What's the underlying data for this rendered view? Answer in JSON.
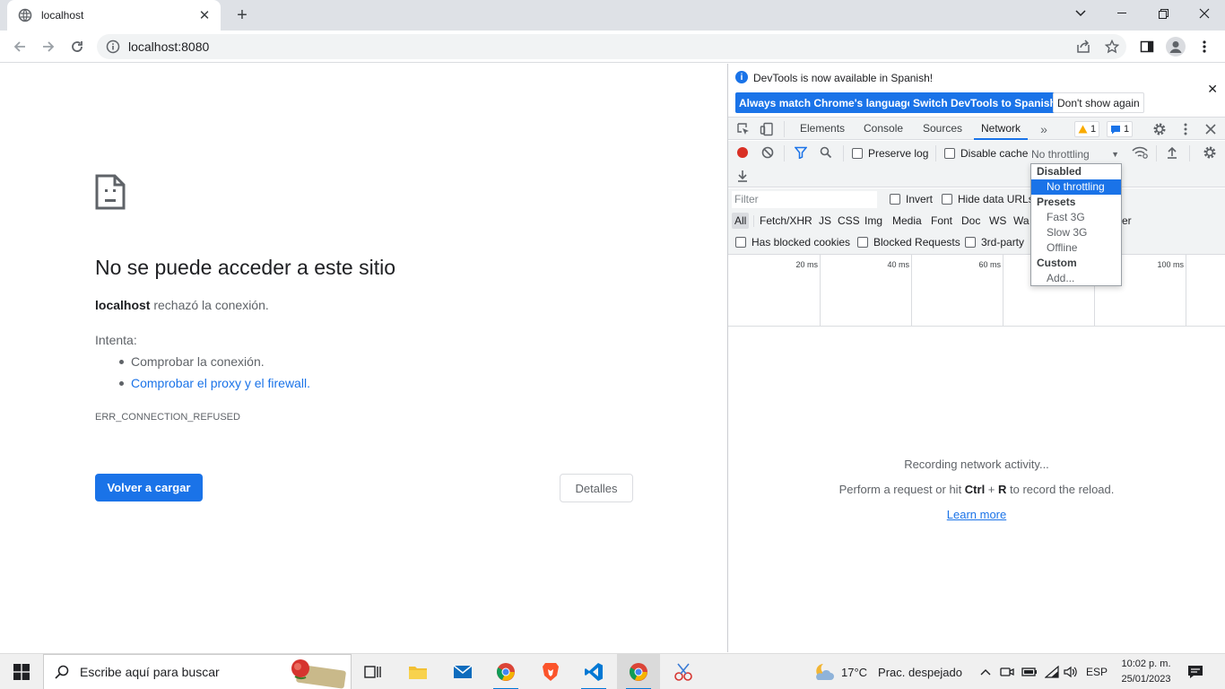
{
  "browser": {
    "tab_title": "localhost",
    "url": "localhost:8080"
  },
  "page": {
    "title": "No se puede acceder a este sitio",
    "host": "localhost",
    "desc_rest": " rechazó la conexión.",
    "try_label": "Intenta:",
    "suggestions": [
      "Comprobar la conexión.",
      "Comprobar el proxy y el firewall."
    ],
    "error_code": "ERR_CONNECTION_REFUSED",
    "reload_label": "Volver a cargar",
    "details_label": "Detalles"
  },
  "devtools": {
    "infobar": {
      "message": "DevTools is now available in Spanish!",
      "btn_match": "Always match Chrome's language",
      "btn_switch": "Switch DevTools to Spanish",
      "btn_dont": "Don't show again"
    },
    "tabs": [
      "Elements",
      "Console",
      "Sources",
      "Network"
    ],
    "active_tab": "Network",
    "warnings": "1",
    "messages": "1",
    "toolbar": {
      "preserve_log": "Preserve log",
      "disable_cache": "Disable cache",
      "throttling": "No throttling"
    },
    "filter": {
      "placeholder": "Filter",
      "invert": "Invert",
      "hide_data_urls": "Hide data URLs",
      "types": [
        "All",
        "Fetch/XHR",
        "JS",
        "CSS",
        "Img",
        "Media",
        "Font",
        "Doc",
        "WS",
        "Wa"
      ],
      "types_tail": "er",
      "has_blocked_cookies": "Has blocked cookies",
      "blocked_requests": "Blocked Requests",
      "third_party": "3rd-party"
    },
    "timeline_labels": [
      "20 ms",
      "40 ms",
      "60 ms",
      "100 ms"
    ],
    "empty": {
      "line1": "Recording network activity...",
      "line2_pre": "Perform a request or hit ",
      "line2_ctrl": "Ctrl",
      "line2_plus": " + ",
      "line2_r": "R",
      "line2_post": " to record the reload.",
      "learn_more": "Learn more"
    },
    "throttle_menu": {
      "group_disabled": "Disabled",
      "no_throttling": "No throttling",
      "group_presets": "Presets",
      "fast3g": "Fast 3G",
      "slow3g": "Slow 3G",
      "offline": "Offline",
      "group_custom": "Custom",
      "add": "Add..."
    }
  },
  "taskbar": {
    "search_placeholder": "Escribe aquí para buscar",
    "weather_temp": "17°C",
    "weather_desc": "Prac. despejado",
    "language": "ESP",
    "time": "10:02 p. m.",
    "date": "25/01/2023"
  },
  "colors": {
    "accent": "#1a73e8",
    "chrome_bg": "#dee1e6",
    "devtools_bar": "#f1f3f4",
    "record_red": "#d93025"
  }
}
